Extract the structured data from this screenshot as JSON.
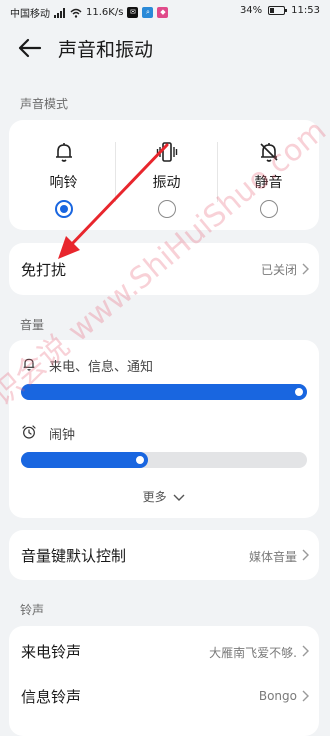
{
  "status_bar": {
    "carrier": "中国移动",
    "speed": "11.6K/s",
    "battery": "34%",
    "battery_level": 0.34,
    "time": "11:53"
  },
  "header": {
    "title": "声音和振动",
    "back_icon": "arrow-left-icon"
  },
  "sound_mode": {
    "section_label": "声音模式",
    "modes": [
      {
        "label": "响铃",
        "icon": "bell-icon",
        "selected": true
      },
      {
        "label": "振动",
        "icon": "vibrate-icon",
        "selected": false
      },
      {
        "label": "静音",
        "icon": "bell-off-icon",
        "selected": false
      }
    ]
  },
  "dnd": {
    "title": "免打扰",
    "value": "已关闭"
  },
  "volume": {
    "section_label": "音量",
    "items": [
      {
        "label": "来电、信息、通知",
        "icon": "bell-icon",
        "level": 1.0
      },
      {
        "label": "闹钟",
        "icon": "alarm-clock-icon",
        "level": 0.41
      }
    ],
    "more_label": "更多"
  },
  "volume_key": {
    "title": "音量键默认控制",
    "value": "媒体音量"
  },
  "ringtone": {
    "section_label": "铃声",
    "rows": [
      {
        "title": "来电铃声",
        "value": "大雁南飞爱不够."
      },
      {
        "title": "信息铃声",
        "value": "Bongo"
      }
    ]
  },
  "watermark": "识会说 www.ShiHuiShuo.com",
  "colors": {
    "accent": "#1966e0",
    "background": "#f1f3f5",
    "card": "#ffffff",
    "annotation_arrow": "#e8262d"
  }
}
